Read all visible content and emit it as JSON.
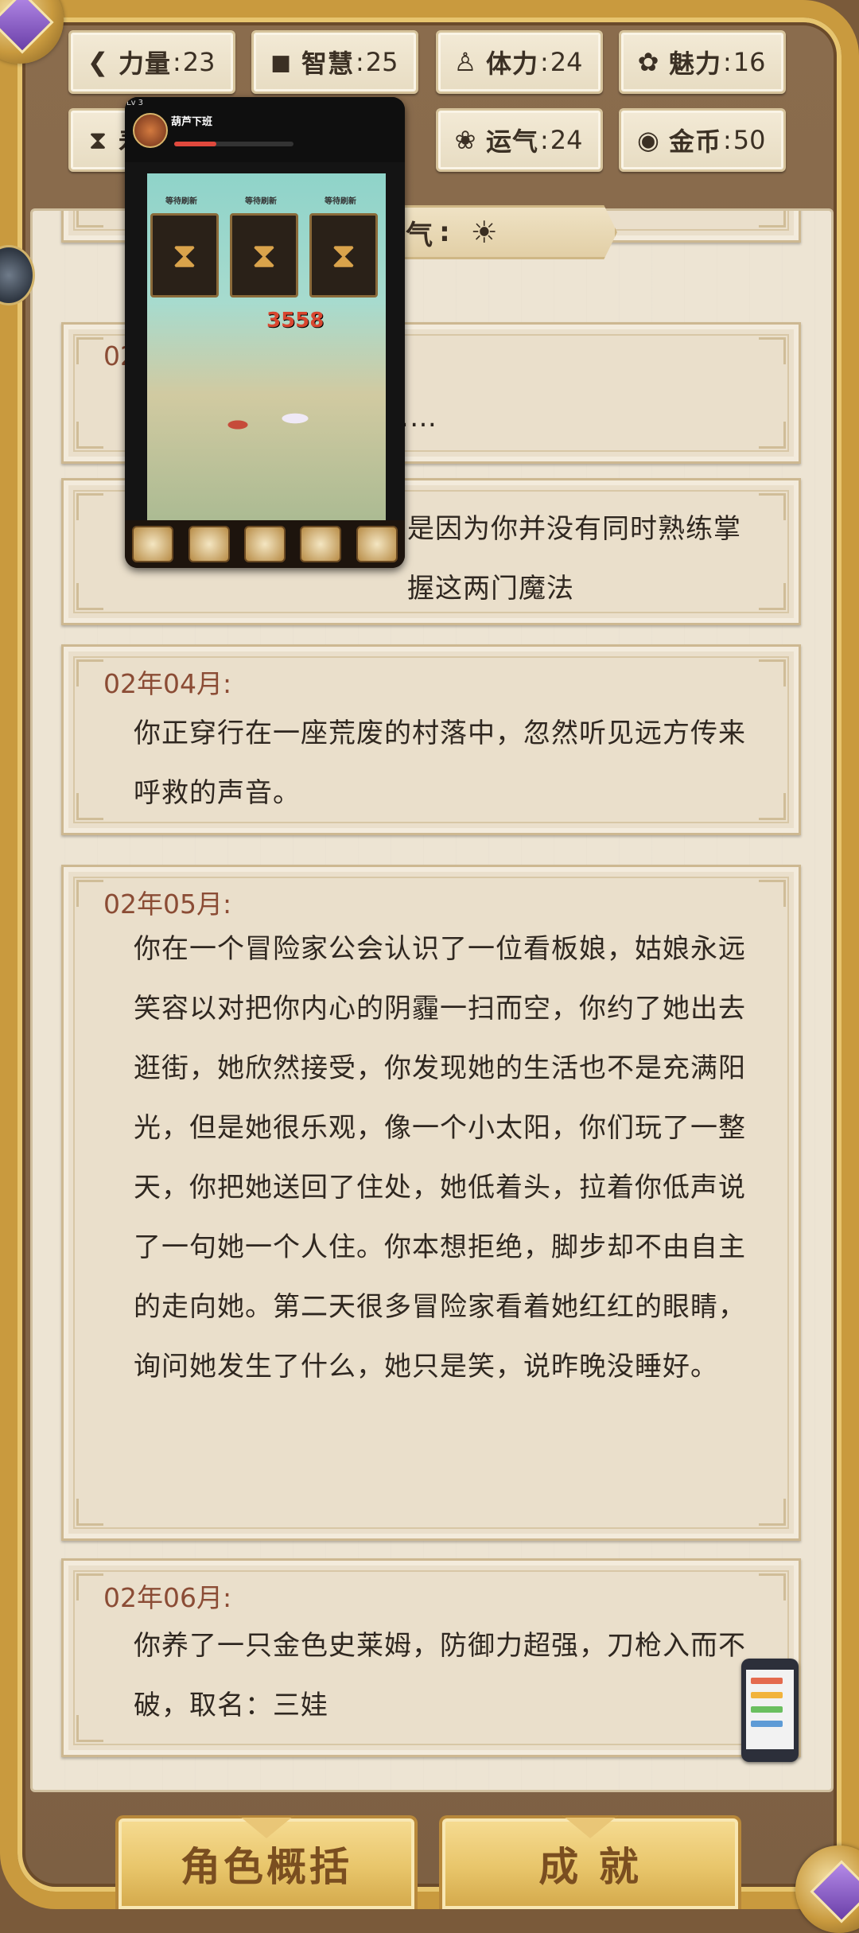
{
  "stats": [
    {
      "id": "strength",
      "icon": "strength-icon",
      "label": "力量",
      "value": "23"
    },
    {
      "id": "wisdom",
      "icon": "wisdom-icon",
      "label": "智慧",
      "value": "25"
    },
    {
      "id": "stamina",
      "icon": "stamina-icon",
      "label": "体力",
      "value": "24"
    },
    {
      "id": "charm",
      "icon": "charm-icon",
      "label": "魅力",
      "value": "16"
    },
    {
      "id": "time",
      "icon": "hourglass-icon",
      "label": "寿",
      "value": ""
    },
    {
      "id": "luck",
      "icon": "luck-icon",
      "label": "运气",
      "value": "24"
    },
    {
      "id": "gold",
      "icon": "coin-icon",
      "label": "金币",
      "value": "50"
    }
  ],
  "weather": {
    "label": "气",
    "icon": "sun-icon"
  },
  "log": [
    {
      "id": "e1",
      "date": "02",
      "text": "……"
    },
    {
      "id": "e2",
      "date": "",
      "text": "是因为你并没有同时熟练掌握这两门魔法"
    },
    {
      "id": "e3",
      "date": "02年04月:",
      "text": "你正穿行在一座荒废的村落中，忽然听见远方传来呼救的声音。"
    },
    {
      "id": "e4",
      "date": "02年05月:",
      "text": "你在一个冒险家公会认识了一位看板娘，姑娘永远笑容以对把你内心的阴霾一扫而空，你约了她出去逛街，她欣然接受，你发现她的生活也不是充满阳光，但是她很乐观，像一个小太阳，你们玩了一整天，你把她送回了住处，她低着头，拉着你低声说了一句她一个人住。你本想拒绝，脚步却不由自主的走向她。第二天很多冒险家看着她红红的眼睛，询问她发生了什么，她只是笑，说昨晚没睡好。"
    },
    {
      "id": "e5",
      "date": "02年06月:",
      "text": "你养了一只金色史莱姆，防御力超强，刀枪入而不破，取名：三娃"
    }
  ],
  "buttons": {
    "summary": "角色概括",
    "achievements": "成 就"
  },
  "overlay": {
    "player_name": "葫芦下班",
    "level": "Lv 3",
    "hourglass_label": "等待刷新",
    "damage": "3558",
    "colors": {
      "sky": "#8fd3c9",
      "ground": "#a5b890"
    }
  },
  "colors": {
    "frame_gold": "#c99a3e",
    "panel_bg": "#ede4d3",
    "date_text": "#8b4c35",
    "body_text": "#2f2720",
    "button_gold": "#e8c56a"
  }
}
